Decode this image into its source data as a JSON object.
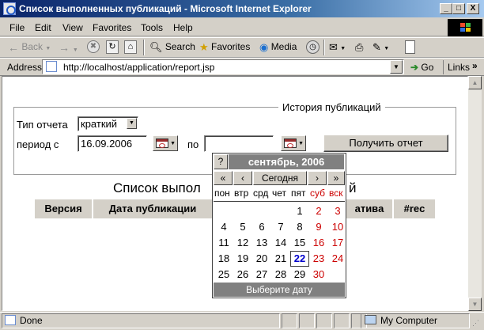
{
  "window": {
    "title": "Список выполненных публикаций - Microsoft Internet Explorer",
    "btn_min": "_",
    "btn_max": "□",
    "btn_close": "X"
  },
  "menu": [
    "File",
    "Edit",
    "View",
    "Favorites",
    "Tools",
    "Help"
  ],
  "toolbar": {
    "back": "Back",
    "search": "Search",
    "favorites": "Favorites",
    "media": "Media",
    "dropdown_arrow": "▼"
  },
  "address": {
    "label": "Address",
    "url": "http://localhost/application/report.jsp",
    "go": "Go",
    "links": "Links",
    "more": "»"
  },
  "form": {
    "legend": "История публикаций",
    "report_type_label": "Тип отчета",
    "report_type_value": "краткий",
    "period_from_label": "период с",
    "period_from_value": "16.09.2006",
    "period_to_label": "по",
    "period_to_value": "",
    "submit": "Получить отчет"
  },
  "report": {
    "title_visible": "Список выпол",
    "title_tail": "й",
    "columns": [
      "Версия",
      "Дата публикации",
      "",
      "ативa",
      "#rec"
    ]
  },
  "calendar": {
    "help": "?",
    "month_title": "сентябрь, 2006",
    "nav": {
      "prev_year": "«",
      "prev_month": "‹",
      "today": "Сегодня",
      "next_month": "›",
      "next_year": "»"
    },
    "weekdays": [
      "пон",
      "втр",
      "срд",
      "чет",
      "пят",
      "суб",
      "вск"
    ],
    "weeks": [
      [
        "",
        "",
        "",
        "",
        "1",
        "2",
        "3"
      ],
      [
        "4",
        "5",
        "6",
        "7",
        "8",
        "9",
        "10"
      ],
      [
        "11",
        "12",
        "13",
        "14",
        "15",
        "16",
        "17"
      ],
      [
        "18",
        "19",
        "20",
        "21",
        "22",
        "23",
        "24"
      ],
      [
        "25",
        "26",
        "27",
        "28",
        "29",
        "30",
        ""
      ]
    ],
    "today": "22",
    "footer": "Выберите дату",
    "weekend_color": "#cc0000",
    "today_color": "#0000cc"
  },
  "status": {
    "left": "Done",
    "zone": "My Computer"
  },
  "colors": {
    "titlebar_start": "#0a246a",
    "face": "#d4d0c8"
  }
}
